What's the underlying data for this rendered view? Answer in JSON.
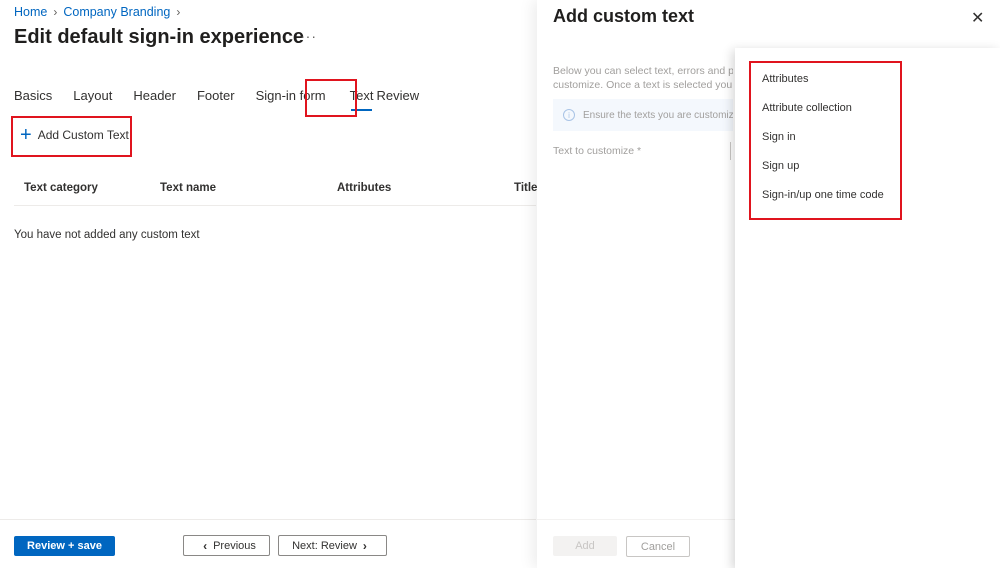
{
  "breadcrumb": [
    {
      "label": "Home"
    },
    {
      "label": "Company Branding"
    }
  ],
  "page_title": "Edit default sign-in experience",
  "more_label": "···",
  "tabs": [
    {
      "label": "Basics",
      "active": false
    },
    {
      "label": "Layout",
      "active": false
    },
    {
      "label": "Header",
      "active": false
    },
    {
      "label": "Footer",
      "active": false
    },
    {
      "label": "Sign-in form",
      "active": false
    },
    {
      "label": "Text",
      "active": true
    },
    {
      "label": "Review",
      "active": false
    }
  ],
  "add_custom_text": {
    "icon": "plus-icon",
    "label": "Add Custom Text"
  },
  "table": {
    "columns": [
      "Text category",
      "Text name",
      "Attributes",
      "Title"
    ],
    "empty_message": "You have not added any custom text"
  },
  "footer": {
    "review_save": "Review + save",
    "previous": "Previous",
    "next": "Next: Review"
  },
  "panel": {
    "title": "Add custom text",
    "close_icon": "close-icon",
    "description_line1": "Below you can select text, errors and pr",
    "description_line2": "customize. Once a text is selected you c",
    "info_text": "Ensure the texts you are customizing",
    "field_label": "Text to customize *",
    "add_button": "Add",
    "cancel_button": "Cancel"
  },
  "dropdown": {
    "options": [
      "Attributes",
      "Attribute collection",
      "Sign in",
      "Sign up",
      "Sign-in/up one time code"
    ]
  },
  "colors": {
    "accent": "#0066c0",
    "highlight": "#e0141e"
  }
}
